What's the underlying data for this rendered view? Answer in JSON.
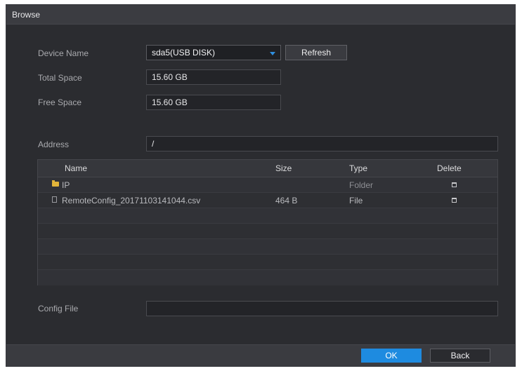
{
  "window": {
    "title": "Browse"
  },
  "form": {
    "device_name_label": "Device Name",
    "device_name_value": "sda5(USB DISK)",
    "refresh_label": "Refresh",
    "total_space_label": "Total Space",
    "total_space_value": "15.60 GB",
    "free_space_label": "Free Space",
    "free_space_value": "15.60 GB",
    "address_label": "Address",
    "address_value": "/",
    "config_file_label": "Config File",
    "config_file_value": ""
  },
  "table": {
    "columns": [
      "Name",
      "Size",
      "Type",
      "Delete"
    ],
    "rows": [
      {
        "icon": "folder-icon",
        "name": "IP",
        "size": "",
        "type": "Folder"
      },
      {
        "icon": "file-icon",
        "name": "RemoteConfig_20171103141044.csv",
        "size": "464 B",
        "type": "File"
      }
    ]
  },
  "footer": {
    "ok_label": "OK",
    "back_label": "Back"
  },
  "colors": {
    "accent": "#1e8be0",
    "folder": "#e2b43a",
    "panel": "#2b2c30"
  }
}
